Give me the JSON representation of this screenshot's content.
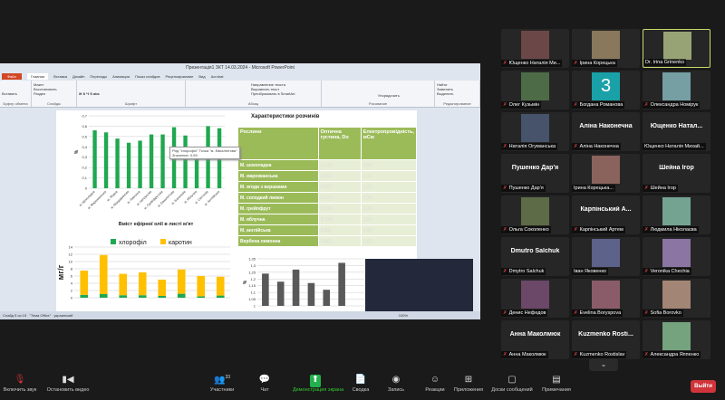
{
  "powerpoint": {
    "title": "Презентація1 ЗКТ 14.03.2024 - Microsoft PowerPoint",
    "tabs": [
      "Файл",
      "Главная",
      "Вставка",
      "Дизайн",
      "Переходы",
      "Анимация",
      "Показ слайдов",
      "Рецензирование",
      "Вид",
      "Acrobat"
    ],
    "ribbon_groups": [
      "Буфер обмена",
      "Слайды",
      "Шрифт",
      "Абзац",
      "Рисование",
      "Редактирование"
    ],
    "ribbon_buttons": {
      "paste": "Вставить",
      "new_slide": "Создать слайд",
      "layout": "Макет",
      "reset": "Восстановить",
      "section": "Раздел",
      "text_dir": "Направление текста",
      "align_text": "Выровнять текст",
      "smartart": "Преобразовать в SmartArt",
      "arrange": "Упорядочить",
      "quick_styles": "Экспресс-стили",
      "find": "Найти",
      "replace": "Заменить",
      "select": "Выделить"
    },
    "status": {
      "slide": "Слайд 5 из 15",
      "theme": "\"Тема Office\"",
      "lang": "украинский",
      "zoom": "100%"
    }
  },
  "slide": {
    "table_title": "Характеристики розчинів",
    "table_headers": [
      "Рослини",
      "Оптична густина, Do",
      "Електропровідність, мСм"
    ],
    "table_rows": [
      [
        "М. шоколадна",
        "3,125",
        "0,94"
      ],
      [
        "М. марокканська",
        "3,162",
        "1,19"
      ],
      [
        "М. ягоди з вершками",
        "3,870",
        "1,31"
      ],
      [
        "М. солодкий лимон",
        "3,171",
        "1,19"
      ],
      [
        "М. грейпфрут",
        "2,504",
        "1,26"
      ],
      [
        "М. яблучна",
        "3, 765",
        "1,51"
      ],
      [
        "М. англійська",
        "3,831",
        "1,41"
      ],
      [
        "Вербена лимонна",
        "3,921",
        "1,91"
      ]
    ],
    "tooltip": [
      "Ряд \"хлорофіл\" Точка \"м. Евкаліптова\"",
      "Значение: 0,59"
    ]
  },
  "chart_data": [
    {
      "type": "bar",
      "title": "Вміст ефірної олії в листі м'ят",
      "ylabel": "%",
      "ylim": [
        0,
        0.7
      ],
      "yticks": [
        "0",
        "0,1",
        "0,2",
        "0,3",
        "0,4",
        "0,5",
        "0,6",
        "0,7"
      ],
      "categories": [
        "м. Шоколадна",
        "м. Марокканська",
        "м. Ягідна",
        "м. Мандаринова",
        "м. Лимонна",
        "м. Цитрусова",
        "м. Грейпфрутова",
        "м. Евкаліптова",
        "м. Бананова",
        "м. Яблучна",
        "м. Світлова",
        "м. Англійська"
      ],
      "values": [
        0.56,
        0.54,
        0.48,
        0.44,
        0.46,
        0.52,
        0.52,
        0.59,
        0.51,
        0.4,
        0.6,
        0.58
      ],
      "color": "#1fa84f"
    },
    {
      "type": "bar",
      "stacked": true,
      "ylabel": "мг/г",
      "ylim": [
        0,
        14
      ],
      "yticks": [
        "0",
        "2",
        "4",
        "6",
        "8",
        "10",
        "12",
        "14"
      ],
      "legend": [
        "хлорофіл",
        "каротин"
      ],
      "legend_position": "top",
      "series": [
        {
          "name": "хлорофіл",
          "values": [
            0.8,
            1.0,
            0.7,
            0.7,
            0.5,
            1.1,
            0.4,
            0.6
          ],
          "color": "#1fa84f"
        },
        {
          "name": "каротин",
          "values": [
            6.7,
            10.8,
            5.9,
            6.3,
            4.5,
            6.7,
            5.6,
            5.2
          ],
          "color": "#ffc000"
        }
      ]
    },
    {
      "type": "bar",
      "ylabel": "%",
      "ylim": [
        1,
        1.35
      ],
      "yticks": [
        "1",
        "1,05",
        "1,1",
        "1,15",
        "1,2",
        "1,25",
        "1,3",
        "1,35"
      ],
      "values": [
        1.24,
        1.18,
        1.27,
        1.17,
        1.12,
        1.32
      ],
      "color": "#595959"
    }
  ],
  "participants": [
    {
      "name": "Ющенко Наталія Ми...",
      "video": true
    },
    {
      "name": "Ірина Корецька",
      "video": true
    },
    {
      "name": "Dr. Irina Grinenko",
      "video": true,
      "active": true,
      "muted": false
    },
    {
      "name": "Олег Кузьмін",
      "video": true
    },
    {
      "name": "Богдана Романова",
      "avatar": "3"
    },
    {
      "name": "Олександра Номірук",
      "video": true
    },
    {
      "name": "Наталія Огуманська",
      "video": true
    },
    {
      "name": "Аліна Наконечна",
      "big": "Аліна Наконечна"
    },
    {
      "name": "Ющенко Наталія Михай...",
      "big": "Ющенко  Натал...",
      "muted": false
    },
    {
      "name": "Пушенко Дар'я",
      "big": "Пушенко Дар'я"
    },
    {
      "name": "Ірина Корецька...",
      "video": true,
      "muted": false
    },
    {
      "name": "Шейна Ігор",
      "big": "Шейна Ігор"
    },
    {
      "name": "Ольга Соколенко",
      "video": true
    },
    {
      "name": "Карпінський Артем",
      "big": "Карпінський  А..."
    },
    {
      "name": "Людмила Ніколаєва",
      "video": true
    },
    {
      "name": "Dmytro Salchuk",
      "big": "Dmutro Salchuk"
    },
    {
      "name": "Іван Яковенко",
      "video": true,
      "muted": false
    },
    {
      "name": "Veronika Chechia",
      "video": true
    },
    {
      "name": "Денис Нефедов",
      "video": true
    },
    {
      "name": "Evelina Boryspova",
      "video": true
    },
    {
      "name": "Sofia Borovko",
      "video": true
    },
    {
      "name": "Анна Маколмюк",
      "big": "Анна Маколмюк"
    },
    {
      "name": "Kuzmenko Rostislav",
      "big": "Kuzmenko  Rosti..."
    },
    {
      "name": "Александра Яппенко",
      "video": true
    }
  ],
  "toolbar": {
    "items": [
      {
        "label": "Включить звук",
        "icon": "mic-muted-icon",
        "glyph": "🎙"
      },
      {
        "label": "Остановить видео",
        "icon": "video-icon",
        "glyph": "▮◀"
      },
      {
        "label": "Участники",
        "icon": "participants-icon",
        "glyph": "👥",
        "count": "33"
      },
      {
        "label": "Чат",
        "icon": "chat-icon",
        "glyph": "💬"
      },
      {
        "label": "Демонстрация экрана",
        "icon": "share-screen-icon",
        "glyph": "⬆"
      },
      {
        "label": "Сводка",
        "icon": "summary-icon",
        "glyph": "📄"
      },
      {
        "label": "Запись",
        "icon": "record-icon",
        "glyph": "◉"
      },
      {
        "label": "Реакции",
        "icon": "reactions-icon",
        "glyph": "☺"
      },
      {
        "label": "Приложения",
        "icon": "apps-icon",
        "glyph": "⊞"
      },
      {
        "label": "Доски сообщений",
        "icon": "whiteboard-icon",
        "glyph": "▢"
      },
      {
        "label": "Примечания",
        "icon": "notes-icon",
        "glyph": "▤"
      }
    ],
    "leave": "Выйти"
  }
}
